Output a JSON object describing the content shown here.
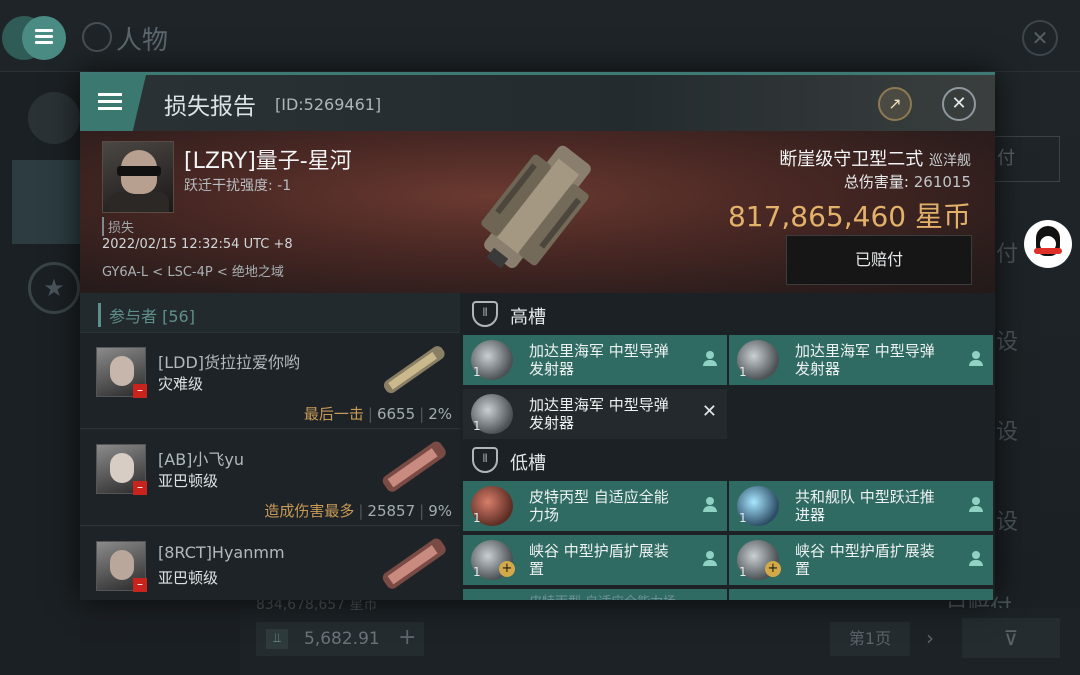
{
  "background": {
    "title": "人物",
    "right_texts": [
      "付",
      "付",
      "设",
      "设",
      "设",
      "已赔付"
    ],
    "strip_text": "834,678,657 星币",
    "bottom_value": "5,682.91",
    "page_label": "第1页"
  },
  "modal": {
    "title": "损失报告",
    "id_label": "[ID:5269461]",
    "pilot": {
      "name": "[LZRY]量子-星河",
      "jam_label": "跃迁干扰强度: -1",
      "loss_tag": "损失",
      "datetime": "2022/02/15 12:32:54 UTC +8",
      "location": "GY6A-L < LSC-4P < 绝地之域"
    },
    "ship": {
      "name": "断崖级守卫型二式",
      "class": "巡洋舰",
      "damage_label": "总伤害量:",
      "damage_value": "261015",
      "value": "817,865,460",
      "currency": "星币",
      "paid_label": "已赔付"
    },
    "participants": {
      "header": "参与者 [56]",
      "rows": [
        {
          "name": "[LDD]货拉拉爱你哟",
          "ship": "灾难级",
          "tag": "最后一击",
          "damage": "6655",
          "pct": "2%"
        },
        {
          "name": "[AB]小飞yu",
          "ship": "亚巴顿级",
          "tag": "造成伤害最多",
          "damage": "25857",
          "pct": "9%"
        },
        {
          "name": "[8RCT]Hyanmm",
          "ship": "亚巴顿级",
          "tag": "",
          "damage": "",
          "pct": ""
        }
      ]
    },
    "fitting": {
      "high_label": "高槽",
      "low_label": "低槽",
      "high": [
        {
          "name": "加达里海军 中型导弹发射器",
          "qty": "1",
          "state": "destroyed"
        },
        {
          "name": "加达里海军 中型导弹发射器",
          "qty": "1",
          "state": "destroyed"
        },
        {
          "name": "加达里海军 中型导弹发射器",
          "qty": "1",
          "state": "dropped"
        }
      ],
      "low": [
        {
          "name": "皮特丙型 自适应全能力场",
          "qty": "1",
          "state": "destroyed"
        },
        {
          "name": "共和舰队 中型跃迁推进器",
          "qty": "1",
          "state": "destroyed"
        },
        {
          "name": "峡谷 中型护盾扩展装置",
          "qty": "1",
          "state": "destroyed"
        },
        {
          "name": "峡谷 中型护盾扩展装置",
          "qty": "1",
          "state": "destroyed"
        }
      ],
      "peek_text": "皮特丙型 自适应全能力场"
    }
  }
}
